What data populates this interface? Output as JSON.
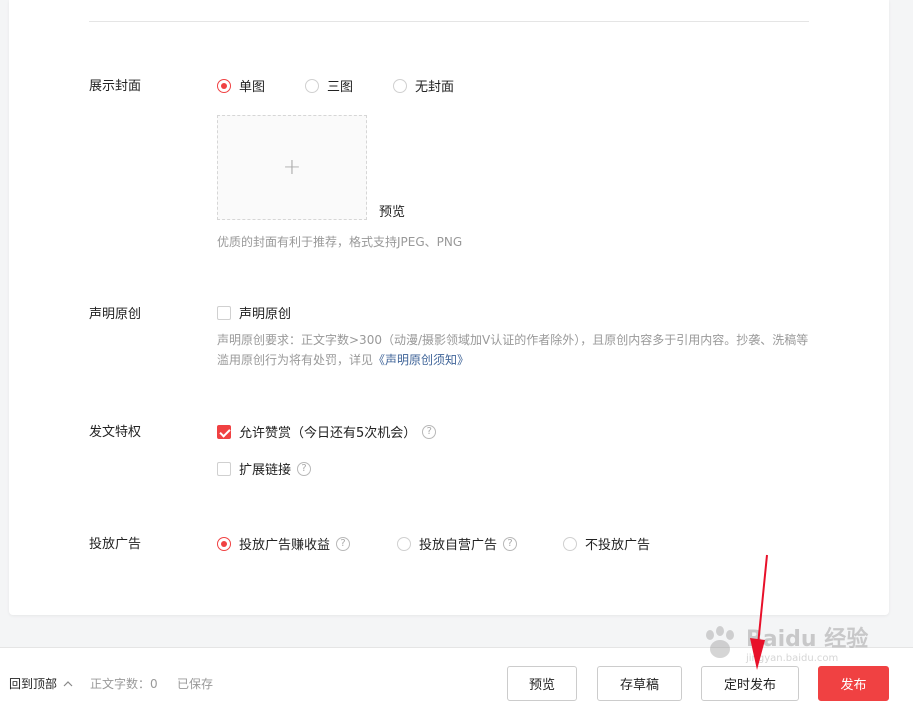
{
  "cover": {
    "label": "展示封面",
    "options": [
      {
        "label": "单图",
        "selected": true
      },
      {
        "label": "三图",
        "selected": false
      },
      {
        "label": "无封面",
        "selected": false
      }
    ],
    "upload_icon": "plus-icon",
    "upload_glyph": "+",
    "preview_label": "预览",
    "hint": "优质的封面有利于推荐，格式支持JPEG、PNG"
  },
  "original": {
    "label": "声明原创",
    "checkbox_label": "声明原创",
    "checked": false,
    "hint_line1": "声明原创要求：正文字数>300（动漫/摄影领域加V认证的作者除外），且原创内容多于引用内容。抄袭、洗稿等",
    "hint_line2_prefix": "滥用原创行为将有处罚，详见",
    "hint_link": "《声明原创须知》"
  },
  "privilege": {
    "label": "发文特权",
    "allow_reward": {
      "label": "允许赞赏（今日还有5次机会）",
      "checked": true
    },
    "extended_link": {
      "label": "扩展链接",
      "checked": false
    },
    "help_glyph": "?"
  },
  "ads": {
    "label": "投放广告",
    "options": [
      {
        "label": "投放广告赚收益",
        "selected": true,
        "help": true
      },
      {
        "label": "投放自营广告",
        "selected": false,
        "help": true
      },
      {
        "label": "不投放广告",
        "selected": false,
        "help": false
      }
    ]
  },
  "bottom_bar": {
    "back_to_top": "回到顶部",
    "chevron_icon": "chevron-up-icon",
    "word_count": "正文字数：0",
    "saved_status": "已保存",
    "preview_button": "预览",
    "draft_button": "存草稿",
    "schedule_button": "定时发布",
    "publish_button": "发布"
  },
  "watermark": {
    "text": "Baidu 经验",
    "sub": "jingyan.baidu.com"
  },
  "colors": {
    "accent": "#f04142",
    "link": "#406599",
    "annotation_arrow": "#e8102a"
  }
}
